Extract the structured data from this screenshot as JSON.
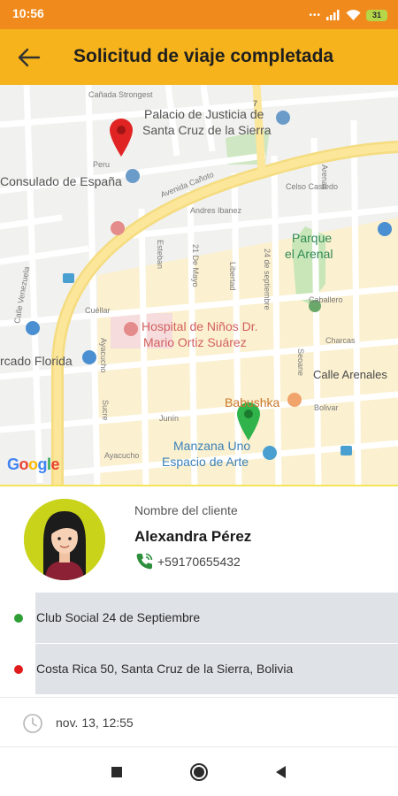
{
  "status_bar": {
    "time": "10:56",
    "battery": "31"
  },
  "app_bar": {
    "title": "Solicitud de viaje completada",
    "back_icon": "arrow-left-icon"
  },
  "map": {
    "labels": {
      "canada_strongest": "Cañada Strongest",
      "palacio_1": "Palacio de Justicia de",
      "palacio_2": "Santa Cruz de la Sierra",
      "consulado": "Consulado de España",
      "av_canoto": "Avenida Cañoto",
      "andres_ibanez": "Andres Ibanez",
      "celso_castedo": "Celso Castedo",
      "parque_1": "Parque",
      "parque_2": "el Arenal",
      "hospital_1": "Hospital de Niños Dr.",
      "hospital_2": "Mario Ortiz Suárez",
      "mercado": "rcado Florida",
      "calle_arenales": "Calle Arenales",
      "charcas": "Charcas",
      "caballero": "Caballero",
      "babushka": "Babushka",
      "bolivar": "Bolivar",
      "manzana_1": "Manzana Uno",
      "manzana_2": "Espacio de Arte",
      "cuellar": "Cuéllar",
      "junin": "Junín",
      "ayacucho": "Ayacucho",
      "sucre": "Sucre",
      "calle_venezuela": "Calle Venezuela",
      "esteban": "Esteban",
      "ayacucho2": "Ayacucho",
      "lucero": "Libertad",
      "calle_21": "21 De Mayo",
      "calle_24": "24 de septiembre",
      "arenita": "Arenas",
      "peru": "Peru",
      "seoane": "Seoane",
      "route": "7",
      "google": [
        "G",
        "o",
        "o",
        "g",
        "l",
        "e"
      ]
    },
    "origin_color": "#2fb34a",
    "destination_color": "#e02424"
  },
  "client": {
    "label": "Nombre del cliente",
    "name": "Alexandra Pérez",
    "phone": "+59170655432",
    "avatar_icon": "avatar-icon",
    "phone_icon": "phone-icon"
  },
  "trip": {
    "origin": "Club Social 24 de Septiembre",
    "destination": "Costa Rica 50, Santa Cruz de la Sierra, Bolivia",
    "origin_dot_color": "#2e9e35",
    "destination_dot_color": "#e01b1b",
    "time": "nov. 13, 12:55",
    "clock_icon": "clock-icon"
  },
  "nav": {
    "recents": "square-icon",
    "home": "circle-icon",
    "back": "triangle-back-icon"
  }
}
